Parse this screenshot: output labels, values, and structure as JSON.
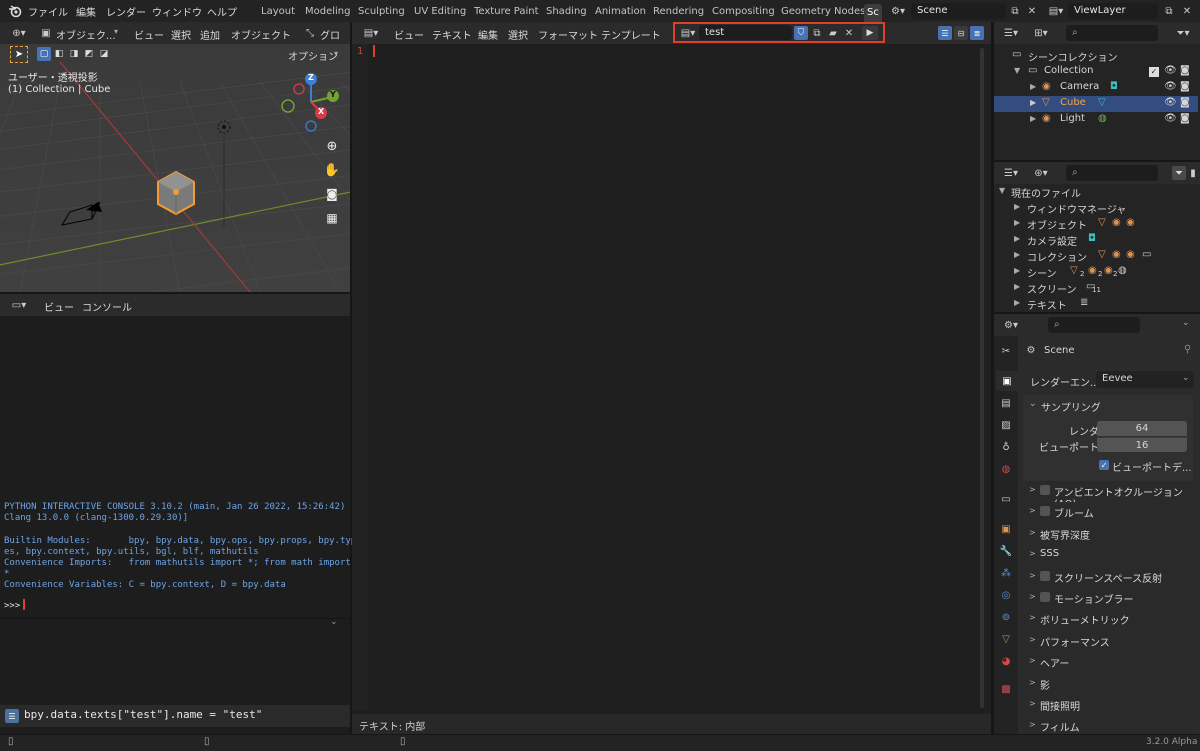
{
  "topbar": {
    "menus": [
      "ファイル",
      "編集",
      "レンダー",
      "ウィンドウ",
      "ヘルプ"
    ],
    "workspaces": [
      "Layout",
      "Modeling",
      "Sculpting",
      "UV Editing",
      "Texture Paint",
      "Shading",
      "Animation",
      "Rendering",
      "Compositing",
      "Geometry Nodes",
      "Sc"
    ],
    "scene_name": "Scene",
    "view_layer": "ViewLayer"
  },
  "viewport": {
    "header_items": [
      "オブジェク...",
      "ビュー",
      "選択",
      "追加",
      "オブジェクト",
      "グロー..."
    ],
    "options_label": "オプション",
    "view_label": "ユーザー・透視投影",
    "context_label": "(1) Collection | Cube",
    "gizmo": {
      "z": "Z",
      "y": "Y",
      "x": "X"
    }
  },
  "console": {
    "header_items": [
      "ビュー",
      "コンソール"
    ],
    "lines": [
      "PYTHON INTERACTIVE CONSOLE 3.10.2 (main, Jan 26 2022, 15:26:42) [",
      "Clang 13.0.0 (clang-1300.0.29.30)]",
      "",
      "Builtin Modules:       bpy, bpy.data, bpy.ops, bpy.props, bpy.typ",
      "es, bpy.context, bpy.utils, bgl, blf, mathutils",
      "Convenience Imports:   from mathutils import *; from math import",
      "*",
      "Convenience Variables: C = bpy.context, D = bpy.data"
    ],
    "prompt": ">>>"
  },
  "info": {
    "message": "bpy.data.texts[\"test\"].name = \"test\""
  },
  "text_editor": {
    "header_items": [
      "ビュー",
      "テキスト",
      "編集",
      "選択",
      "フォーマット",
      "テンプレート"
    ],
    "text_name": "test",
    "line_number": "1",
    "footer": "テキスト: 内部"
  },
  "outliner": {
    "title": "シーンコレクション",
    "rows": [
      {
        "label": "Collection",
        "indent": 1
      },
      {
        "label": "Camera",
        "indent": 2
      },
      {
        "label": "Cube",
        "indent": 2,
        "selected": true
      },
      {
        "label": "Light",
        "indent": 2
      }
    ]
  },
  "blend_file": {
    "title": "現在のファイル",
    "rows": [
      "ウィンドウマネージャ",
      "オブジェクト",
      "カメラ設定",
      "コレクション",
      "シーン",
      "スクリーン",
      "テキスト"
    ],
    "badges": {
      "scene_counts": [
        "2",
        "2",
        "2"
      ],
      "screen_count": "11"
    }
  },
  "properties": {
    "scene": "Scene",
    "render_engine_label": "レンダーエン...",
    "render_engine": "Eevee",
    "sampling": {
      "title": "サンプリング",
      "render_label": "レンダー",
      "render_value": "64",
      "viewport_label": "ビューポート",
      "viewport_value": "16",
      "viewport_denoise": "ビューポートデ..."
    },
    "panels": [
      {
        "label": "アンビエントオクルージョン(AO)",
        "checkbox": true
      },
      {
        "label": "ブルーム",
        "checkbox": true
      },
      {
        "label": "被写界深度",
        "checkbox": false
      },
      {
        "label": "SSS",
        "checkbox": false
      },
      {
        "label": "スクリーンスペース反射",
        "checkbox": true
      },
      {
        "label": "モーションブラー",
        "checkbox": true
      },
      {
        "label": "ボリューメトリック",
        "checkbox": false
      },
      {
        "label": "パフォーマンス",
        "checkbox": false
      },
      {
        "label": "ヘアー",
        "checkbox": false
      },
      {
        "label": "影",
        "checkbox": false
      },
      {
        "label": "間接照明",
        "checkbox": false
      },
      {
        "label": "フィルム",
        "checkbox": false
      }
    ]
  },
  "statusbar": {
    "version": "3.2.0 Alpha"
  },
  "colors": {
    "accent_blue": "#4772b3",
    "highlight_red": "#e0402a",
    "object_orange": "#e09450"
  }
}
